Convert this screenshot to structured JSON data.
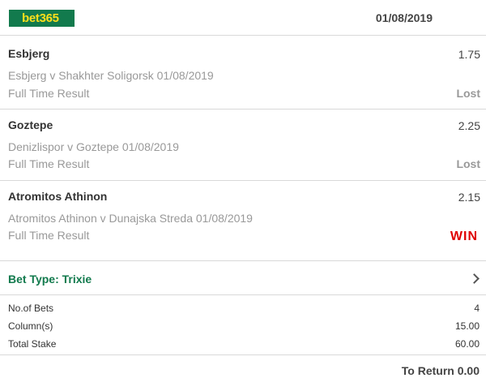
{
  "header": {
    "logo_text": "bet365",
    "date": "01/08/2019"
  },
  "selections": [
    {
      "name": "Esbjerg",
      "odds": "1.75",
      "event": "Esbjerg v Shakhter Soligorsk 01/08/2019",
      "market": "Full Time Result",
      "result": "Lost"
    },
    {
      "name": "Goztepe",
      "odds": "2.25",
      "event": "Denizlispor v Goztepe 01/08/2019",
      "market": "Full Time Result",
      "result": "Lost"
    },
    {
      "name": "Atromitos Athinon",
      "odds": "2.15",
      "event": "Atromitos Athinon v Dunajska Streda 01/08/2019",
      "market": "Full Time Result",
      "result": "WIN"
    }
  ],
  "bet_type": {
    "label": "Bet Type: Trixie",
    "icon": "chevron-right-icon"
  },
  "summary": [
    {
      "label": "No.of Bets",
      "value": "4"
    },
    {
      "label": "Column(s)",
      "value": "15.00"
    },
    {
      "label": "Total Stake",
      "value": "60.00"
    }
  ],
  "footer": {
    "to_return": "To Return 0.00"
  },
  "colors": {
    "brand_green": "#127a4d",
    "logo_yellow": "#ffdf1b",
    "win_red": "#e00000",
    "muted": "#999999"
  }
}
